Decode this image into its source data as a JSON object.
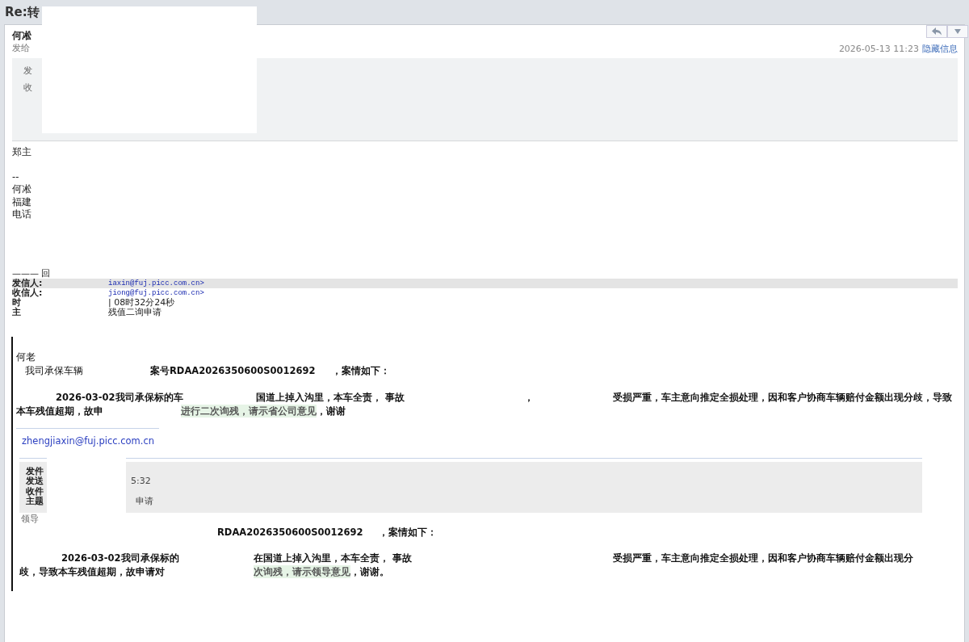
{
  "window": {
    "title": "Re:转"
  },
  "message": {
    "sender": "何凇",
    "to_label": "发给",
    "date": "2026-05-13 11:23",
    "toggle_link": "隐藏信息",
    "info_labels": [
      "发",
      "收"
    ],
    "body_lines": [
      "郑主",
      "--",
      "何凇",
      "福建",
      "电话"
    ]
  },
  "quoted_header": {
    "divider": "——— 回",
    "fields": [
      {
        "label": "发信人:",
        "value": "iaxin@fuj.picc.com.cn>",
        "kind": "email",
        "highlighted": true
      },
      {
        "label": "收信人:",
        "value": "jiong@fuj.picc.com.cn>",
        "kind": "email",
        "highlighted": false
      },
      {
        "label": "时",
        "value": "| 08时32分24秒",
        "kind": "text",
        "highlighted": false
      },
      {
        "label": "主",
        "value": "残值二询申请",
        "kind": "text",
        "highlighted": false
      }
    ]
  },
  "quote": {
    "greeting": "何老",
    "case_line": [
      {
        "text": "我司承保车辆",
        "bold": false
      },
      {
        "text": "案号RDAA2026350600S0012692",
        "bold": true
      },
      {
        "text": "，案情如下：",
        "bold": true
      }
    ],
    "paragraph": [
      [
        {
          "text": "2026-03-02我司承保标的车",
          "highlight": false
        },
        {
          "text": "国道上掉入沟里，本车全责，  事故",
          "highlight": false
        },
        {
          "text": "，",
          "highlight": false
        },
        {
          "text": "受损严重，车主意向推定全损处理，因和客户协商车辆赔付金额出现分歧，导致",
          "highlight": false
        }
      ],
      [
        {
          "text": "本车残值超期，故申",
          "highlight": false
        },
        {
          "text": "进行二次询残，请示省公司意见",
          "highlight": true
        },
        {
          "text": "，谢谢",
          "highlight": false
        }
      ]
    ],
    "link": "zhengjiaxin@fuj.picc.com.cn",
    "inner_header": [
      {
        "label": "发件"
      },
      {
        "label": "发送",
        "value": "5:32"
      },
      {
        "label": "收件"
      },
      {
        "label": "主题",
        "value": "申请"
      }
    ],
    "inner_greeting": "领导",
    "inner_case_line": [
      {
        "text": "RDAA2026350600S0012692",
        "bold": true
      },
      {
        "text": "，案情如下：",
        "bold": true
      }
    ],
    "inner_paragraph": [
      [
        {
          "text": "2026-03-02我司承保标的",
          "highlight": false
        },
        {
          "text": "在国道上掉入沟里，本车全责，  事故",
          "highlight": false
        },
        {
          "text": "受损严重，车主意向推定全损处理，因和客户协商车辆赔付金额出现分",
          "highlight": false
        }
      ],
      [
        {
          "text": "歧，导致本车残值超期，故申请对",
          "highlight": false
        },
        {
          "text": "次询残，请示领导意见",
          "highlight": true
        },
        {
          "text": "，谢谢。",
          "highlight": false
        }
      ]
    ]
  }
}
